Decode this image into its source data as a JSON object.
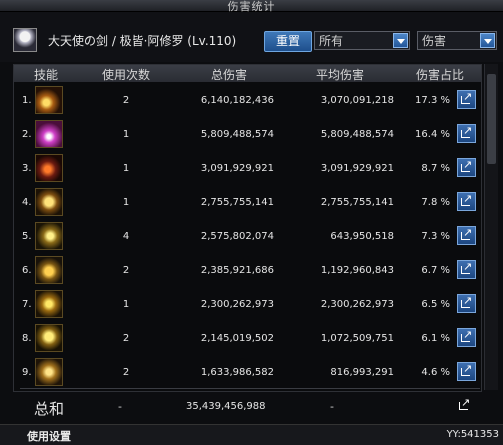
{
  "window": {
    "title": "伤害统计"
  },
  "header": {
    "char_name": "大天使の剑 / 极皆·阿修罗 (Lv.110)",
    "reset_label": "重置",
    "filter_all": "所有",
    "filter_type": "伤害"
  },
  "columns": {
    "skill": "技能",
    "uses": "使用次数",
    "total": "总伤害",
    "avg": "平均伤害",
    "pct": "伤害占比"
  },
  "rows": [
    {
      "idx": "1.",
      "uses": "2",
      "total": "6,140,182,436",
      "avg": "3,070,091,218",
      "pct": "17.3 %"
    },
    {
      "idx": "2.",
      "uses": "1",
      "total": "5,809,488,574",
      "avg": "5,809,488,574",
      "pct": "16.4 %"
    },
    {
      "idx": "3.",
      "uses": "1",
      "total": "3,091,929,921",
      "avg": "3,091,929,921",
      "pct": "8.7 %"
    },
    {
      "idx": "4.",
      "uses": "1",
      "total": "2,755,755,141",
      "avg": "2,755,755,141",
      "pct": "7.8 %"
    },
    {
      "idx": "5.",
      "uses": "4",
      "total": "2,575,802,074",
      "avg": "643,950,518",
      "pct": "7.3 %"
    },
    {
      "idx": "6.",
      "uses": "2",
      "total": "2,385,921,686",
      "avg": "1,192,960,843",
      "pct": "6.7 %"
    },
    {
      "idx": "7.",
      "uses": "1",
      "total": "2,300,262,973",
      "avg": "2,300,262,973",
      "pct": "6.5 %"
    },
    {
      "idx": "8.",
      "uses": "2",
      "total": "2,145,019,502",
      "avg": "1,072,509,751",
      "pct": "6.1 %"
    },
    {
      "idx": "9.",
      "uses": "2",
      "total": "1,633,986,582",
      "avg": "816,993,291",
      "pct": "4.6 %"
    }
  ],
  "summary": {
    "label": "总和",
    "uses": "-",
    "total": "35,439,456,988",
    "avg": "-"
  },
  "footer": {
    "settings_label": "使用设置",
    "yy_label": "YY:541353"
  },
  "colors": {
    "accent": "#2f6bb0",
    "text": "#e6e6e6",
    "bg": "#0c0d10"
  }
}
